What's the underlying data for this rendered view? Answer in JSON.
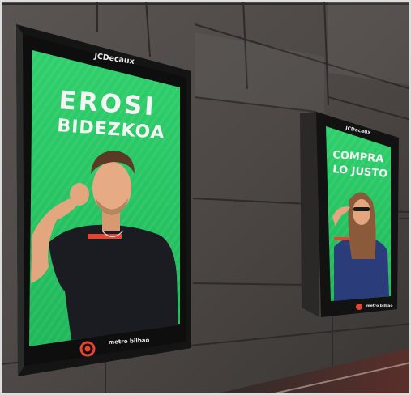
{
  "scene": {
    "colors": {
      "wall": "#4a4644",
      "wall_light": "#6b6561",
      "screen_green": "#28c765",
      "frame": "#1a1a1a",
      "brand_red": "#e8432e"
    }
  },
  "left_screen": {
    "brand": "JCDecaux",
    "headline_line1": "EROSI",
    "headline_line2": "BIDEZKOA",
    "footer_logo": "metro bilbao"
  },
  "right_screen": {
    "brand": "JCDecaux",
    "headline_line1": "COMPRA",
    "headline_line2": "LO JUSTO",
    "footer_logo": "metro bilbao"
  }
}
